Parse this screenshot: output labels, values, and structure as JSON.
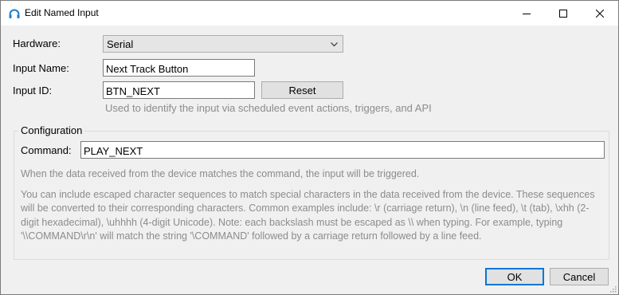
{
  "window": {
    "title": "Edit Named Input",
    "controls": {
      "minimize_icon": "minimize-icon",
      "maximize_icon": "maximize-icon",
      "close_icon": "close-icon"
    }
  },
  "form": {
    "hardware_label": "Hardware:",
    "hardware_value": "Serial",
    "input_name_label": "Input Name:",
    "input_name_value": "Next Track Button",
    "input_id_label": "Input ID:",
    "input_id_value": "BTN_NEXT",
    "reset_label": "Reset",
    "input_id_hint": "Used to identify the input via scheduled event actions, triggers, and API"
  },
  "configuration": {
    "group_label": "Configuration",
    "command_label": "Command:",
    "command_value": "PLAY_NEXT",
    "info_text": "When the data received from the device matches the command, the input will be triggered.",
    "escape_text": "You can include escaped character sequences to match special characters in the data received from the device. These sequences will be converted to their corresponding characters. Common examples include: \\r (carriage return), \\n (line feed), \\t (tab), \\xhh (2-digit hexadecimal), \\uhhhh (4-digit Unicode). Note: each backslash must be escaped as \\\\ when typing. For example, typing '\\\\COMMAND\\r\\n' will match the string '\\COMMAND' followed by a carriage return followed by a line feed."
  },
  "footer": {
    "ok_label": "OK",
    "cancel_label": "Cancel"
  },
  "colors": {
    "accent": "#0078d7",
    "window_bg": "#f0f0f0",
    "hint_text": "#8c8c8c"
  }
}
